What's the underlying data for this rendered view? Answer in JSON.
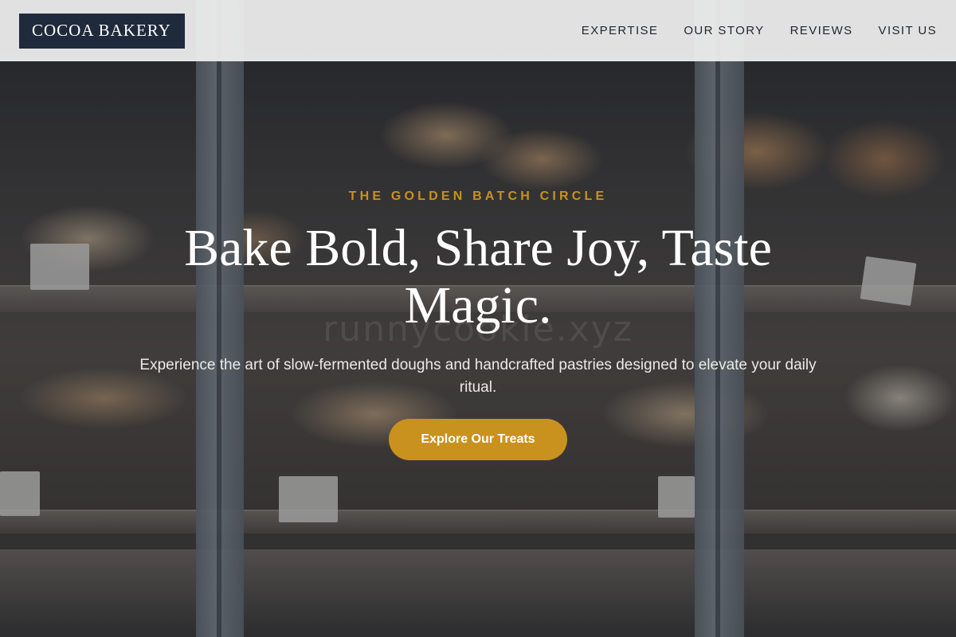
{
  "brand": {
    "logo_text": "COCOA BAKERY"
  },
  "nav": {
    "items": [
      {
        "label": "EXPERTISE"
      },
      {
        "label": "OUR STORY"
      },
      {
        "label": "REVIEWS"
      },
      {
        "label": "VISIT US"
      }
    ]
  },
  "hero": {
    "eyebrow": "THE GOLDEN BATCH CIRCLE",
    "headline": "Bake Bold, Share Joy, Taste Magic.",
    "subtitle": "Experience the art of slow-fermented doughs and handcrafted pastries designed to elevate your daily ritual.",
    "cta_label": "Explore Our Treats",
    "watermark": "runnycookie.xyz"
  },
  "colors": {
    "accent": "#c9921f",
    "logo_background": "#1f2a3c",
    "header_background": "#f0f0f0",
    "headline_text": "#ffffff"
  }
}
